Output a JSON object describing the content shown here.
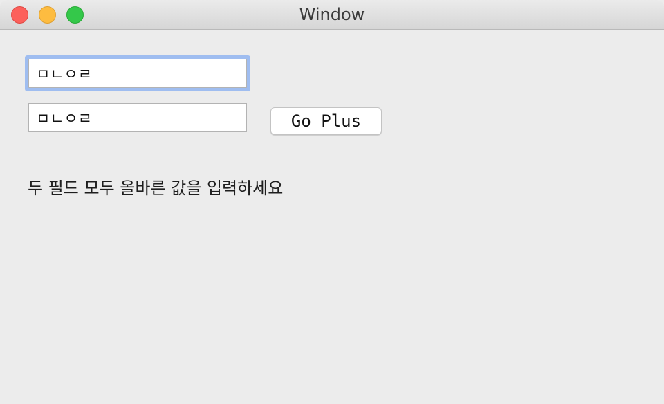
{
  "window": {
    "title": "Window",
    "controls": {
      "close_icon": "close-circle",
      "minimize_icon": "minimize-circle",
      "maximize_icon": "maximize-circle"
    }
  },
  "form": {
    "field1_value": "ㅁㄴㅇㄹ",
    "field2_value": "ㅁㄴㅇㄹ",
    "button_label": "Go Plus",
    "message": "두 필드 모두 올바른 값을 입력하세요"
  },
  "colors": {
    "focus_ring": "#9fbdf0",
    "close": "#fc605b",
    "minimize": "#fdbc40",
    "maximize": "#34c84a"
  }
}
